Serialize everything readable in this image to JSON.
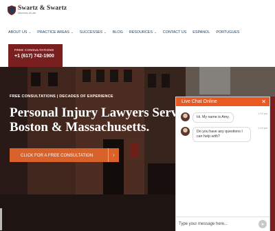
{
  "logo": {
    "title": "Swartz & Swartz",
    "tagline": "Attorneys at Law"
  },
  "nav": {
    "items": [
      {
        "label": "ABOUT US",
        "dropdown": true
      },
      {
        "label": "PRACTICE AREAS",
        "dropdown": true
      },
      {
        "label": "SUCCESSES",
        "dropdown": true
      },
      {
        "label": "BLOG",
        "dropdown": false
      },
      {
        "label": "RESOURCES",
        "dropdown": true
      },
      {
        "label": "CONTACT US",
        "dropdown": false
      },
      {
        "label": "ESPANOL",
        "dropdown": false
      },
      {
        "label": "PORTUGUES",
        "dropdown": false
      }
    ]
  },
  "cta": {
    "label": "FREE CONSULTATIONS",
    "phone": "+1 (617) 742-1900"
  },
  "hero": {
    "eyebrow": "FREE CONSULTATIONS | DECADES OF EXPERIENCE",
    "title_line1": "Personal Injury Lawyers Serving",
    "title_line2": "Boston & Massachusetts.",
    "button_label": "CLICK FOR A FREE CONSULTATION",
    "button_arrow": "›"
  },
  "chat": {
    "title": "Live Chat Online",
    "close": "✕",
    "messages": [
      {
        "text": "Hi. My name is Amy.",
        "time": "1:19 pm"
      },
      {
        "text": "Do you have any questions I can help with?",
        "time": "1:19 pm"
      }
    ],
    "input_placeholder": "Type your message here...",
    "send_icon": "send-arrow-icon"
  },
  "colors": {
    "accent": "#e85a21",
    "brand": "#7a1f1f",
    "nav": "#1e3a55",
    "button": "#d9622b"
  }
}
